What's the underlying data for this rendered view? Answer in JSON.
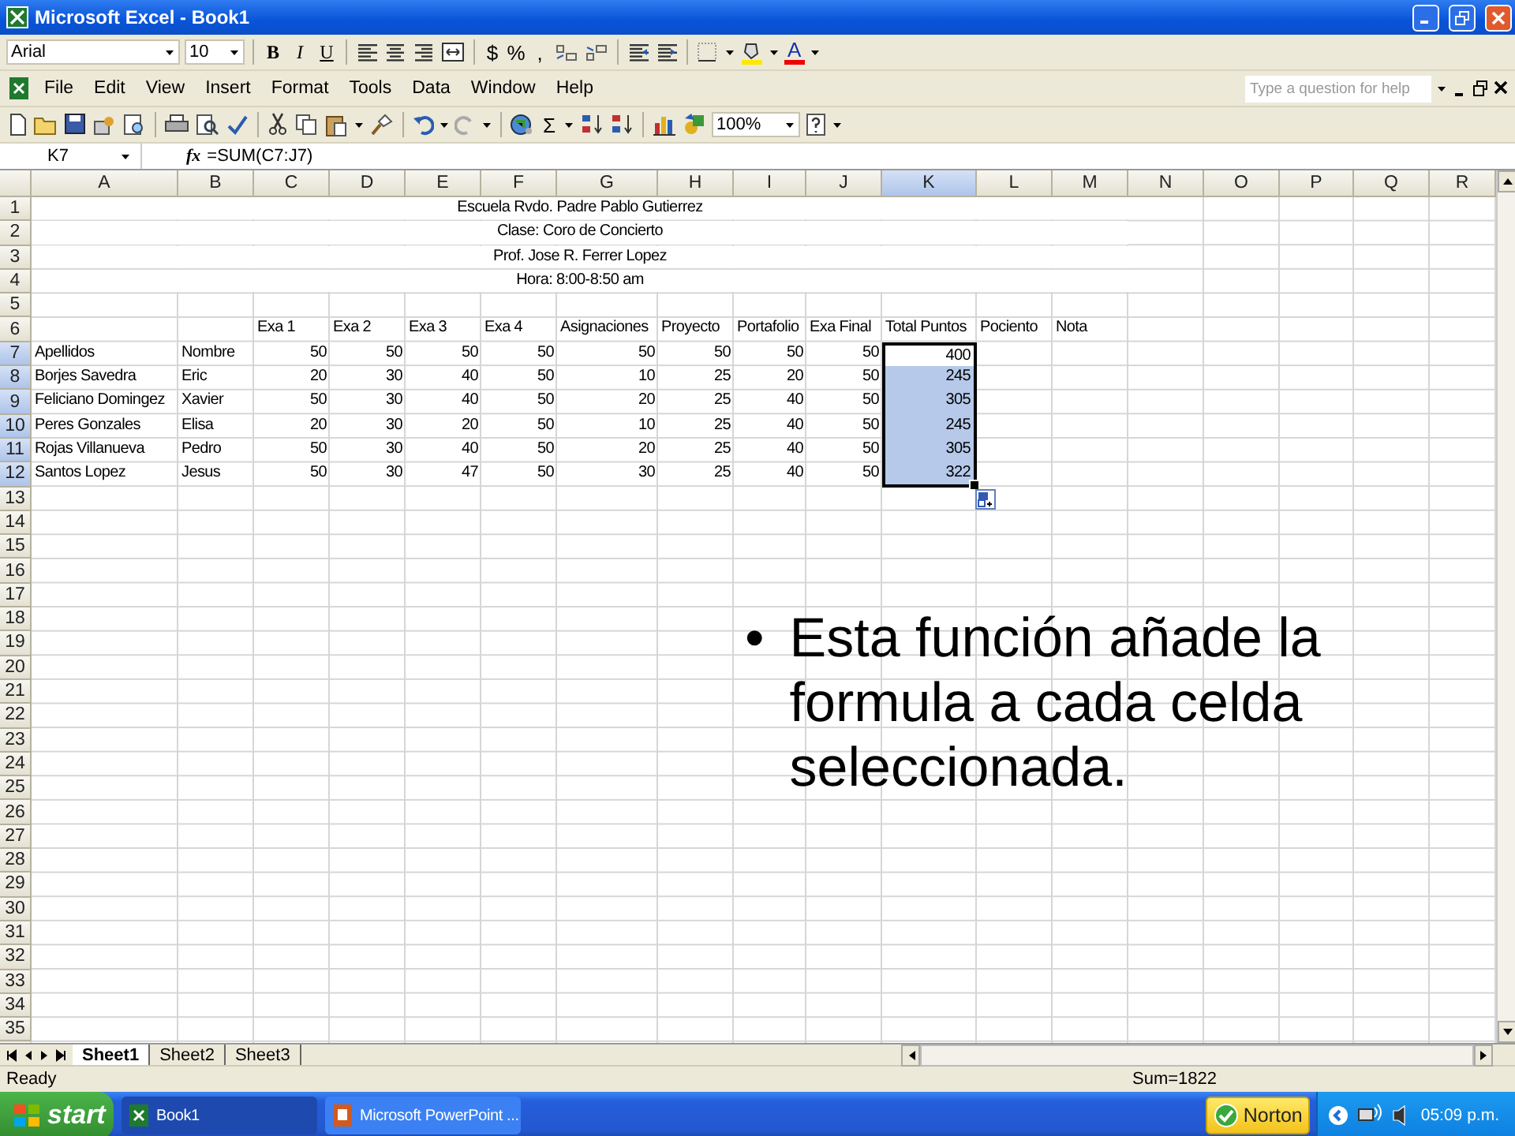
{
  "window": {
    "title": "Microsoft Excel - Book1"
  },
  "formatting_toolbar": {
    "font": "Arial",
    "size": "10",
    "style_buttons": [
      "B",
      "I",
      "U"
    ],
    "number_buttons": [
      "$",
      "%",
      ","
    ],
    "font_color": "A"
  },
  "menu": [
    "File",
    "Edit",
    "View",
    "Insert",
    "Format",
    "Tools",
    "Data",
    "Window",
    "Help"
  ],
  "help_box": {
    "placeholder": "Type a question for help"
  },
  "standard_toolbar": {
    "autosum": "Σ",
    "zoom": "100%"
  },
  "formula_bar": {
    "name_box": "K7",
    "fx": "fx",
    "formula": "=SUM(C7:J7)"
  },
  "sheet": {
    "columns": [
      {
        "label": "A",
        "selected": false
      },
      {
        "label": "B",
        "selected": false
      },
      {
        "label": "C",
        "selected": false
      },
      {
        "label": "D",
        "selected": false
      },
      {
        "label": "E",
        "selected": false
      },
      {
        "label": "F",
        "selected": false
      },
      {
        "label": "G",
        "selected": false
      },
      {
        "label": "H",
        "selected": false
      },
      {
        "label": "I",
        "selected": false
      },
      {
        "label": "J",
        "selected": false
      },
      {
        "label": "K",
        "selected": true
      },
      {
        "label": "L",
        "selected": false
      },
      {
        "label": "M",
        "selected": false
      },
      {
        "label": "N",
        "selected": false
      },
      {
        "label": "O",
        "selected": false
      },
      {
        "label": "P",
        "selected": false
      },
      {
        "label": "Q",
        "selected": false
      },
      {
        "label": "R",
        "selected": false
      }
    ],
    "rows": [
      {
        "header": "1",
        "selected": false,
        "merged": "Escuela Rvdo. Padre Pablo Gutierrez"
      },
      {
        "header": "2",
        "selected": false,
        "merged": "Clase: Coro de Concierto"
      },
      {
        "header": "3",
        "selected": false,
        "merged": "Prof. Jose R. Ferrer Lopez"
      },
      {
        "header": "4",
        "selected": false,
        "merged": "Hora: 8:00-8:50 am"
      },
      {
        "header": "5",
        "selected": false
      },
      {
        "header": "6",
        "selected": false,
        "cells": [
          null,
          null,
          "Exa 1",
          "Exa 2",
          "Exa 3",
          "Exa 4",
          "Asignaciones",
          "Proyecto",
          "Portafolio",
          "Exa Final",
          "Total Puntos",
          "Pociento",
          "Nota"
        ]
      },
      {
        "header": "7",
        "selected": true,
        "cells": [
          "Apellidos",
          "Nombre",
          "50",
          "50",
          "50",
          "50",
          "50",
          "50",
          "50",
          "50",
          {
            "text": "400",
            "selected": true,
            "active": true
          }
        ]
      },
      {
        "header": "8",
        "selected": true,
        "cells": [
          "Borjes Savedra",
          "Eric",
          "20",
          "30",
          "40",
          "50",
          "10",
          "25",
          "20",
          "50",
          {
            "text": "245",
            "selected": true,
            "active": false
          }
        ]
      },
      {
        "header": "9",
        "selected": true,
        "cells": [
          "Feliciano Domingez",
          "Xavier",
          "50",
          "30",
          "40",
          "50",
          "20",
          "25",
          "40",
          "50",
          {
            "text": "305",
            "selected": true,
            "active": false
          }
        ]
      },
      {
        "header": "10",
        "selected": true,
        "cells": [
          "Peres Gonzales",
          "Elisa",
          "20",
          "30",
          "20",
          "50",
          "10",
          "25",
          "40",
          "50",
          {
            "text": "245",
            "selected": true,
            "active": false
          }
        ]
      },
      {
        "header": "11",
        "selected": true,
        "cells": [
          "Rojas Villanueva",
          "Pedro",
          "50",
          "30",
          "40",
          "50",
          "20",
          "25",
          "40",
          "50",
          {
            "text": "305",
            "selected": true,
            "active": false
          }
        ]
      },
      {
        "header": "12",
        "selected": true,
        "cells": [
          "Santos Lopez",
          "Jesus",
          "50",
          "30",
          "47",
          "50",
          "30",
          "25",
          "40",
          "50",
          {
            "text": "322",
            "selected": true,
            "active": false
          }
        ]
      },
      {
        "header": "13",
        "selected": false
      },
      {
        "header": "14",
        "selected": false
      },
      {
        "header": "15",
        "selected": false
      },
      {
        "header": "16",
        "selected": false
      },
      {
        "header": "17",
        "selected": false
      },
      {
        "header": "18",
        "selected": false
      },
      {
        "header": "19",
        "selected": false
      },
      {
        "header": "20",
        "selected": false
      },
      {
        "header": "21",
        "selected": false
      },
      {
        "header": "22",
        "selected": false
      },
      {
        "header": "23",
        "selected": false
      },
      {
        "header": "24",
        "selected": false
      },
      {
        "header": "25",
        "selected": false
      },
      {
        "header": "26",
        "selected": false
      },
      {
        "header": "27",
        "selected": false
      },
      {
        "header": "28",
        "selected": false
      },
      {
        "header": "29",
        "selected": false
      },
      {
        "header": "30",
        "selected": false
      },
      {
        "header": "31",
        "selected": false
      },
      {
        "header": "32",
        "selected": false
      },
      {
        "header": "33",
        "selected": false
      },
      {
        "header": "34",
        "selected": false
      },
      {
        "header": "35",
        "selected": false
      }
    ]
  },
  "sheet_tabs": [
    {
      "label": "Sheet1",
      "selected": true
    },
    {
      "label": "Sheet2",
      "selected": false
    },
    {
      "label": "Sheet3",
      "selected": false
    }
  ],
  "status_bar": {
    "mode": "Ready",
    "sum": "Sum=1822"
  },
  "slide_note": {
    "bullet": "•",
    "text": "Esta función añade la formula a cada celda seleccionada."
  },
  "taskbar": {
    "start": "start",
    "tasks": [
      {
        "label": "Book1",
        "kind": "spreadsheet",
        "selected": true
      },
      {
        "label": "Microsoft PowerPoint ...",
        "kind": "presentation",
        "selected": false
      }
    ],
    "norton": "Norton",
    "clock": "05:09 p.m."
  }
}
